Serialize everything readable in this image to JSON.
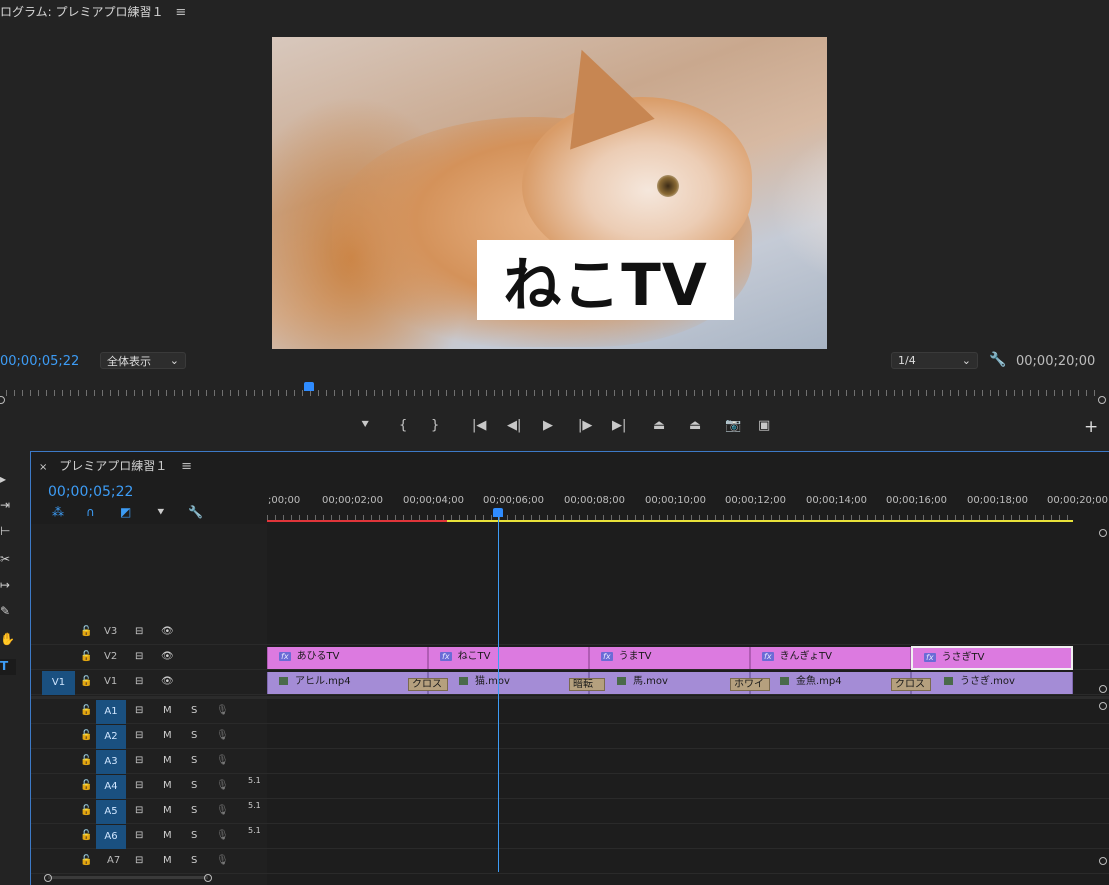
{
  "program_monitor": {
    "title": "ログラム: プレミアプロ練習１",
    "menu_icon": "≡",
    "caption": "ねこTV",
    "timecode": "00;00;05;22",
    "fit": "全体表示",
    "resolution": "1/4",
    "duration": "00;00;20;00",
    "playhead_fraction": 0.283
  },
  "transport": {
    "marker": "⯆",
    "in": "{",
    "out": "}",
    "go_in": "|◀",
    "step_back": "◀|",
    "play": "▶",
    "step_fwd": "|▶",
    "go_out": "▶|",
    "lift": "⏏",
    "extract": "⏏",
    "export_frame": "📷",
    "compare": "▣",
    "add": "+"
  },
  "timeline": {
    "close": "×",
    "sequence_name": "プレミアプロ練習１",
    "menu_icon": "≡",
    "timecode": "00;00;05;22",
    "ruler_labels": [
      ";00;00",
      "00;00;02;00",
      "00;00;04;00",
      "00;00;06;00",
      "00;00;08;00",
      "00;00;10;00",
      "00;00;12;00",
      "00;00;14;00",
      "00;00;16;00",
      "00;00;18;00",
      "00;00;20;00"
    ],
    "video_tracks": [
      {
        "name": "V3"
      },
      {
        "name": "V2"
      },
      {
        "name": "V1",
        "target": "V1"
      }
    ],
    "audio_tracks": [
      {
        "name": "A1",
        "m": "M",
        "s": "S",
        "badge": ""
      },
      {
        "name": "A2",
        "m": "M",
        "s": "S",
        "badge": ""
      },
      {
        "name": "A3",
        "m": "M",
        "s": "S",
        "badge": ""
      },
      {
        "name": "A4",
        "m": "M",
        "s": "S",
        "badge": "5.1"
      },
      {
        "name": "A5",
        "m": "M",
        "s": "S",
        "badge": "5.1"
      },
      {
        "name": "A6",
        "m": "M",
        "s": "S",
        "badge": "5.1"
      },
      {
        "name": "A7",
        "m": "M",
        "s": "S",
        "badge": ""
      }
    ],
    "v2_clips": [
      "あひるTV",
      "ねこTV",
      "うまTV",
      "きんぎょTV",
      "うさぎTV"
    ],
    "v1_clips": [
      "アヒル.mp4",
      "猫.mov",
      "馬.mov",
      "金魚.mp4",
      "うさぎ.mov"
    ],
    "transitions": [
      "クロス",
      "暗転",
      "ホワイ",
      "クロス"
    ],
    "fx_label": "fx"
  },
  "colors": {
    "accent_blue": "#3d9cf5",
    "v2_clip": "#dc7ae0",
    "v1_clip": "#a48cd6",
    "render_red": "#e0353a",
    "render_yellow": "#e8e23a"
  },
  "icons": {
    "lock": "🔓",
    "eye": "👁",
    "mic": "🎙",
    "output": "⊟"
  }
}
